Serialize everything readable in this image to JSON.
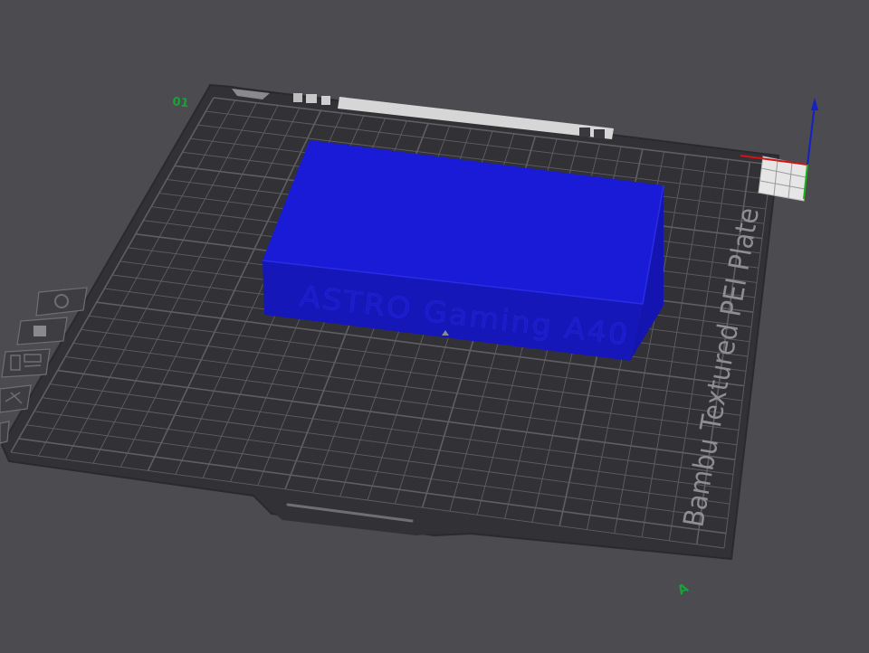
{
  "app": {
    "view": "3D Prepare viewport",
    "background_color": "#4b4b50"
  },
  "plate": {
    "name": "Bambu Textured PEI Plate",
    "plate_color": "#323236",
    "grid_color": "#5e5e63",
    "label_color": "#8e8e93",
    "corner_label_back": "01",
    "corner_label_front": "A"
  },
  "model": {
    "color": "#1a1bd6",
    "embossed_text": "ASTRO Gaming A40"
  },
  "axes": {
    "x_color": "#d21414",
    "y_color": "#19b419",
    "z_color": "#1420c8"
  },
  "side_toolbar": {
    "items": [
      {
        "name": "auto-orient",
        "icon": "settings-hex-icon"
      },
      {
        "name": "arrange",
        "icon": "arrange-icon"
      },
      {
        "name": "layout",
        "icon": "layout-icon"
      },
      {
        "name": "split",
        "icon": "split-icon"
      }
    ]
  }
}
